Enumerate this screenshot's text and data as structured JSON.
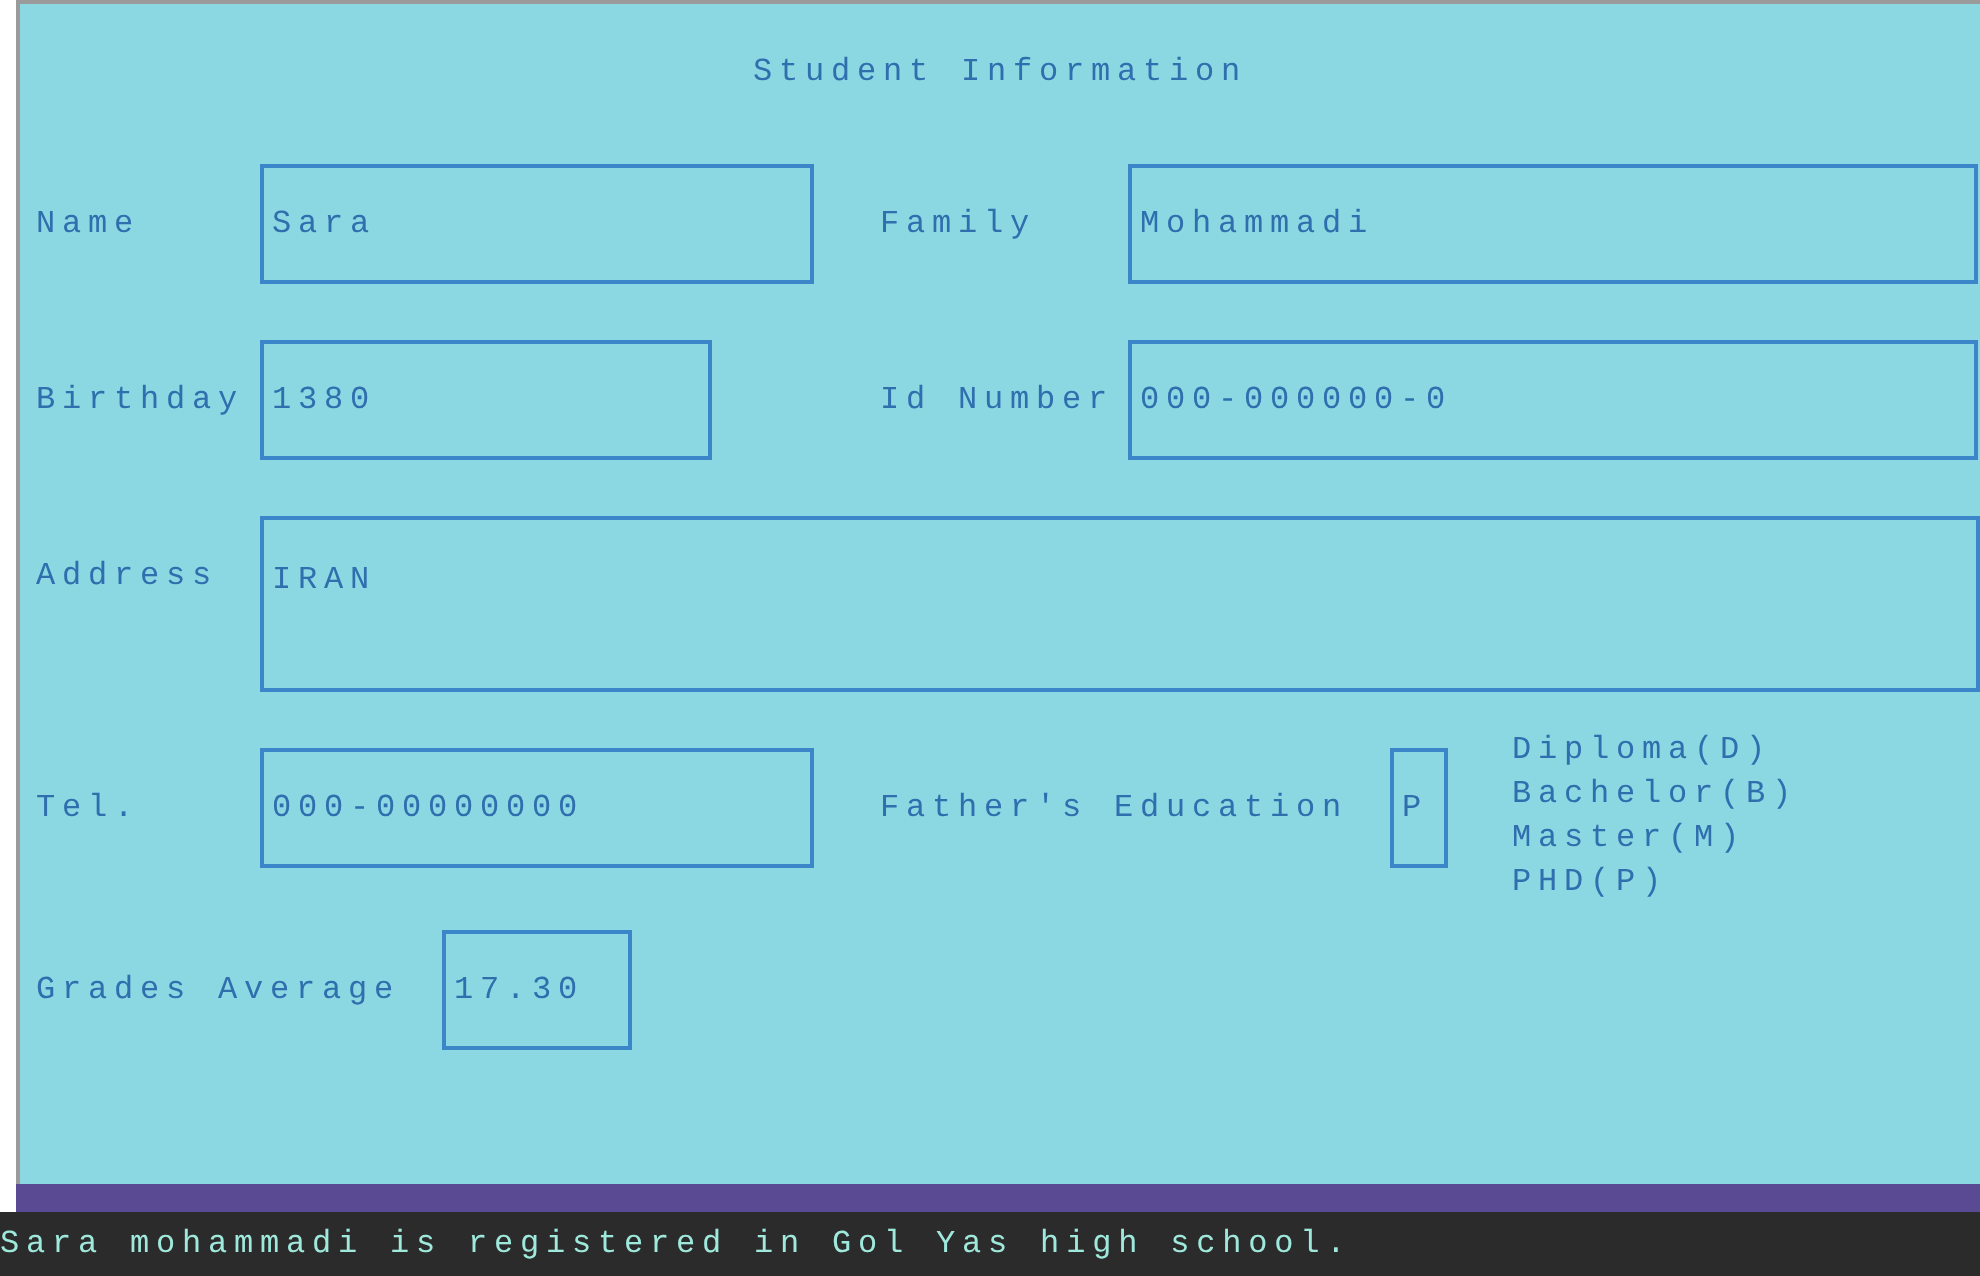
{
  "form": {
    "title": "Student Information",
    "fields": [
      {
        "label": "Name",
        "value": "Sara"
      },
      {
        "label": "Family",
        "value": "Mohammadi"
      },
      {
        "label": "Birthday",
        "value": "1380"
      },
      {
        "label": "Id Number",
        "value": "000-000000-0"
      },
      {
        "label": "Address",
        "value": "IRAN"
      },
      {
        "label": "Tel.",
        "value": "000-00000000"
      },
      {
        "label": "Father's Education",
        "value": "P"
      },
      {
        "label": "Grades Average",
        "value": "17.30"
      }
    ],
    "education_options": [
      "Diploma(D)",
      "Bachelor(B)",
      "Master(M)",
      "PHD(P)"
    ]
  },
  "console": {
    "message": "Sara mohammadi is registered in Gol Yas high school."
  }
}
